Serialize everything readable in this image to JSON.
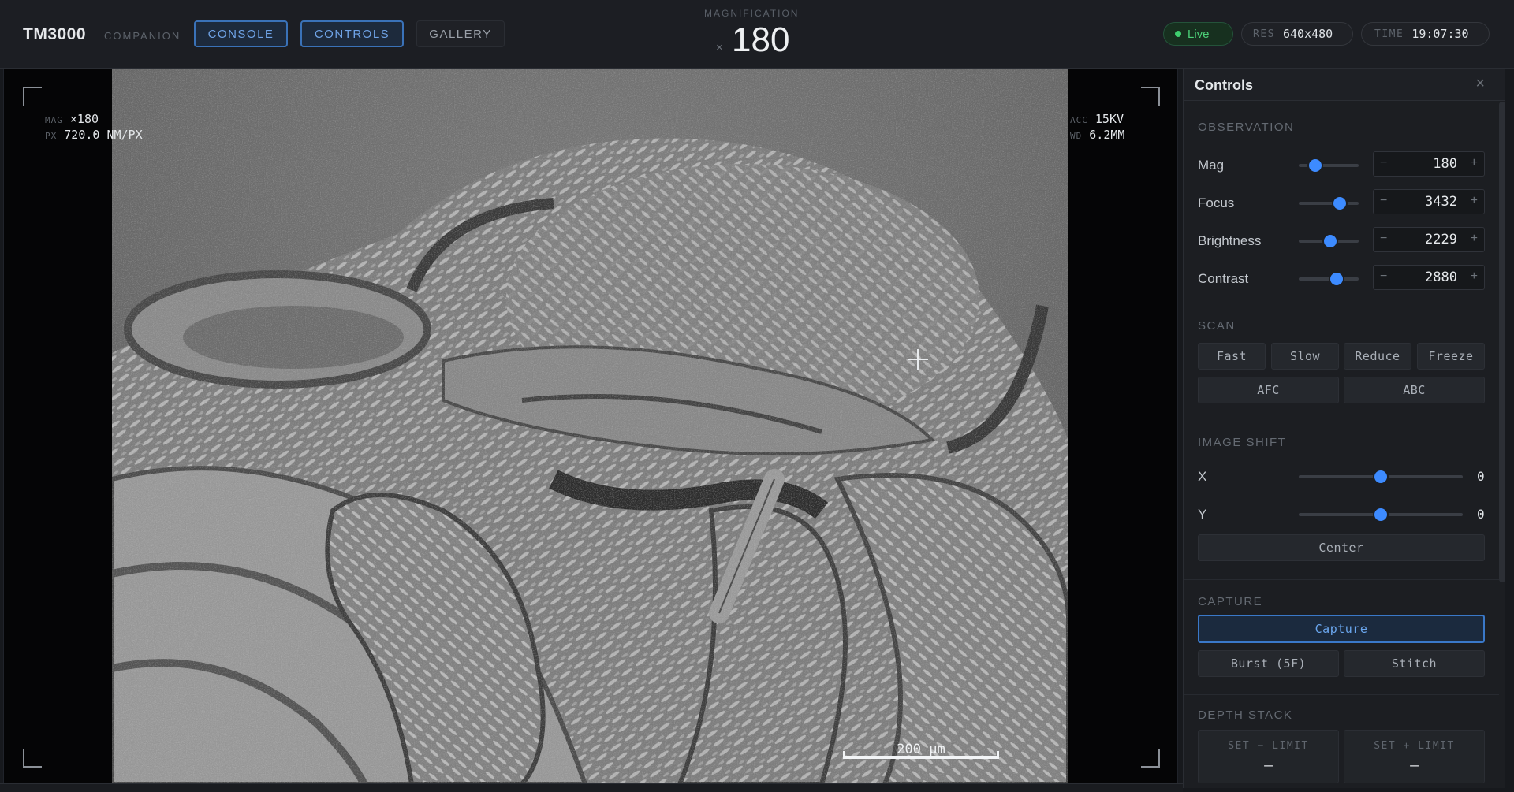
{
  "header": {
    "brand": "TM3000",
    "brand_sub": "COMPANION",
    "tabs": [
      {
        "label": "CONSOLE",
        "active": true
      },
      {
        "label": "CONTROLS",
        "active": true
      },
      {
        "label": "GALLERY",
        "active": false
      }
    ],
    "magnification": {
      "label": "MAGNIFICATION",
      "prefix": "×",
      "value": "180"
    },
    "status": {
      "live": "Live",
      "res_key": "RES",
      "res_value": "640x480",
      "time_key": "TIME",
      "time_value": "19:07:30"
    }
  },
  "viewer": {
    "overlay_left": {
      "mag_key": "MAG",
      "mag_value": "×180",
      "px_key": "PX",
      "px_value": "720.0 NM/PX"
    },
    "overlay_right": {
      "acc_key": "ACC",
      "acc_value": "15KV",
      "wd_key": "WD",
      "wd_value": "6.2MM"
    },
    "scale_bar": "200 µm"
  },
  "panel": {
    "title": "Controls",
    "close": "×",
    "observation": {
      "title": "OBSERVATION",
      "rows": [
        {
          "label": "Mag",
          "value": "180",
          "level": 0.28
        },
        {
          "label": "Focus",
          "value": "3432",
          "level": 0.68
        },
        {
          "label": "Brightness",
          "value": "2229",
          "level": 0.53
        },
        {
          "label": "Contrast",
          "value": "2880",
          "level": 0.63
        }
      ],
      "minus": "−",
      "plus": "+"
    },
    "scan": {
      "title": "SCAN",
      "buttons": [
        "Fast",
        "Slow",
        "Reduce",
        "Freeze"
      ],
      "buttons2": [
        "AFC",
        "ABC"
      ]
    },
    "image_shift": {
      "title": "IMAGE SHIFT",
      "x_label": "X",
      "x_value": "0",
      "x_level": 0.5,
      "y_label": "Y",
      "y_value": "0",
      "y_level": 0.5,
      "center": "Center"
    },
    "capture": {
      "title": "CAPTURE",
      "capture": "Capture",
      "burst": "Burst (5F)",
      "stitch": "Stitch"
    },
    "depth_stack": {
      "title": "DEPTH STACK",
      "set_minus": "SET − LIMIT",
      "set_plus": "SET + LIMIT",
      "minus_value": "—",
      "plus_value": "—"
    }
  },
  "colors": {
    "accent": "#3d8bff",
    "live": "#3fcf6f",
    "background": "#17191d"
  }
}
